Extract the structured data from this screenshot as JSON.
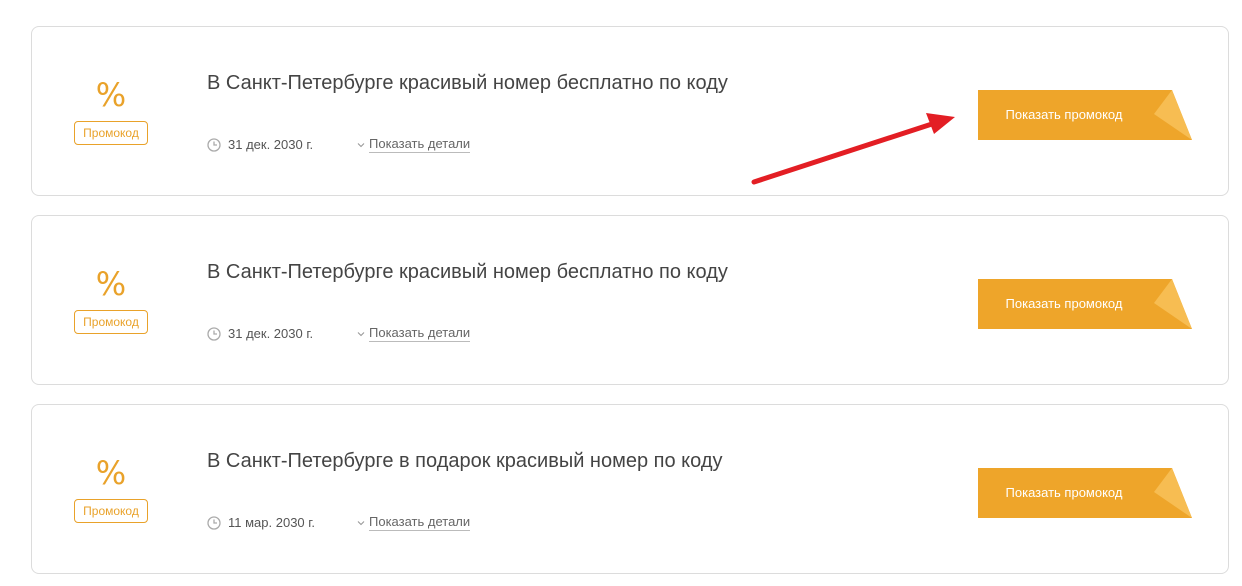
{
  "offers": [
    {
      "icon": "percent-icon",
      "icon_glyph": "%",
      "type_badge": "Промокод",
      "title": "В Санкт-Петербурге красивый номер бесплатно по коду",
      "date": "31 дек. 2030 г.",
      "details_label": "Показать детали",
      "button_label": "Показать промокод"
    },
    {
      "icon": "percent-icon",
      "icon_glyph": "%",
      "type_badge": "Промокод",
      "title": "В Санкт-Петербурге красивый номер бесплатно по коду",
      "date": "31 дек. 2030 г.",
      "details_label": "Показать детали",
      "button_label": "Показать промокод"
    },
    {
      "icon": "percent-icon",
      "icon_glyph": "%",
      "type_badge": "Промокод",
      "title": "В Санкт-Петербурге в подарок красивый номер по коду",
      "date": "11 мар. 2030 г.",
      "details_label": "Показать детали",
      "button_label": "Показать промокод"
    }
  ],
  "colors": {
    "accent": "#e9a22a",
    "button": "#eea52a",
    "button_fold": "#f7bd52",
    "annotation_arrow": "#e31e24",
    "card_border": "#dcdcdc",
    "title_text": "#444444"
  }
}
